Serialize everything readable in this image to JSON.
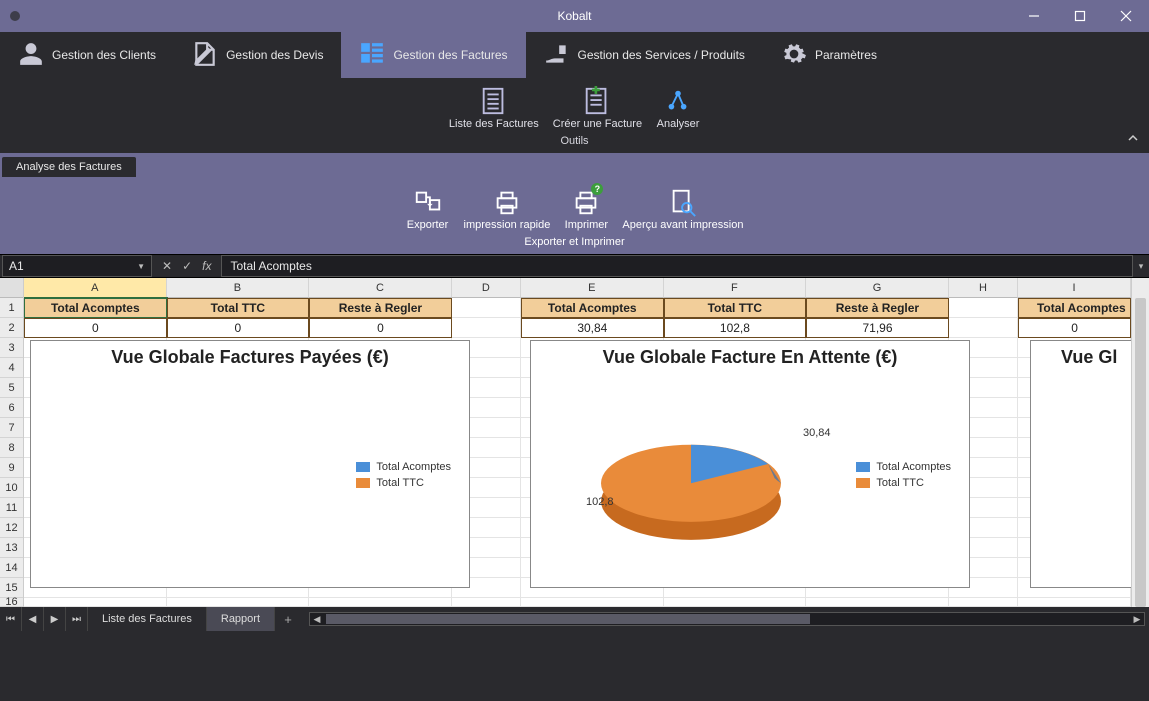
{
  "app": {
    "title": "Kobalt"
  },
  "tabs": {
    "clients": "Gestion des Clients",
    "devis": "Gestion des Devis",
    "factures": "Gestion des Factures",
    "services": "Gestion des Services / Produits",
    "parametres": "Paramètres"
  },
  "ribbon1": {
    "liste": "Liste des Factures",
    "creer": "Créer une Facture",
    "analyser": "Analyser",
    "group": "Outils"
  },
  "subtab": "Analyse des Factures",
  "ribbon2": {
    "exporter": "Exporter",
    "imprrapide": "impression rapide",
    "imprimer": "Imprimer",
    "apercu": "Aperçu avant impression",
    "group": "Exporter et Imprimer"
  },
  "formulabar": {
    "namebox": "A1",
    "formula": "Total Acomptes"
  },
  "columns": [
    "A",
    "B",
    "C",
    "D",
    "E",
    "F",
    "G",
    "H",
    "I"
  ],
  "rows": [
    1,
    2,
    3,
    4,
    5,
    6,
    7,
    8,
    9,
    10,
    11,
    12,
    13,
    14,
    15,
    16
  ],
  "headers": {
    "acomptes": "Total Acomptes",
    "ttc": "Total TTC",
    "reste": "Reste à Regler"
  },
  "table1": {
    "acomptes": "0",
    "ttc": "0",
    "reste": "0"
  },
  "table2": {
    "acomptes": "30,84",
    "ttc": "102,8",
    "reste": "71,96"
  },
  "table3": {
    "acomptes": "0"
  },
  "charts": {
    "left_title": "Vue Globale Factures Payées (€)",
    "mid_title": "Vue Globale Facture En Attente (€)",
    "right_title": "Vue Gl",
    "legend_acomptes": "Total Acomptes",
    "legend_ttc": "Total TTC",
    "label_acomptes": "30,84",
    "label_ttc": "102,8"
  },
  "sheettabs": {
    "liste": "Liste des Factures",
    "rapport": "Rapport"
  },
  "chart_data": [
    {
      "type": "pie",
      "title": "Vue Globale Factures Payées (€)",
      "series": [
        {
          "name": "Total Acomptes",
          "value": 0,
          "color": "#4a8fd8"
        },
        {
          "name": "Total TTC",
          "value": 0,
          "color": "#e98b3a"
        }
      ]
    },
    {
      "type": "pie",
      "title": "Vue Globale Facture En Attente (€)",
      "series": [
        {
          "name": "Total Acomptes",
          "value": 30.84,
          "color": "#4a8fd8"
        },
        {
          "name": "Total TTC",
          "value": 102.8,
          "color": "#e98b3a"
        }
      ]
    }
  ]
}
